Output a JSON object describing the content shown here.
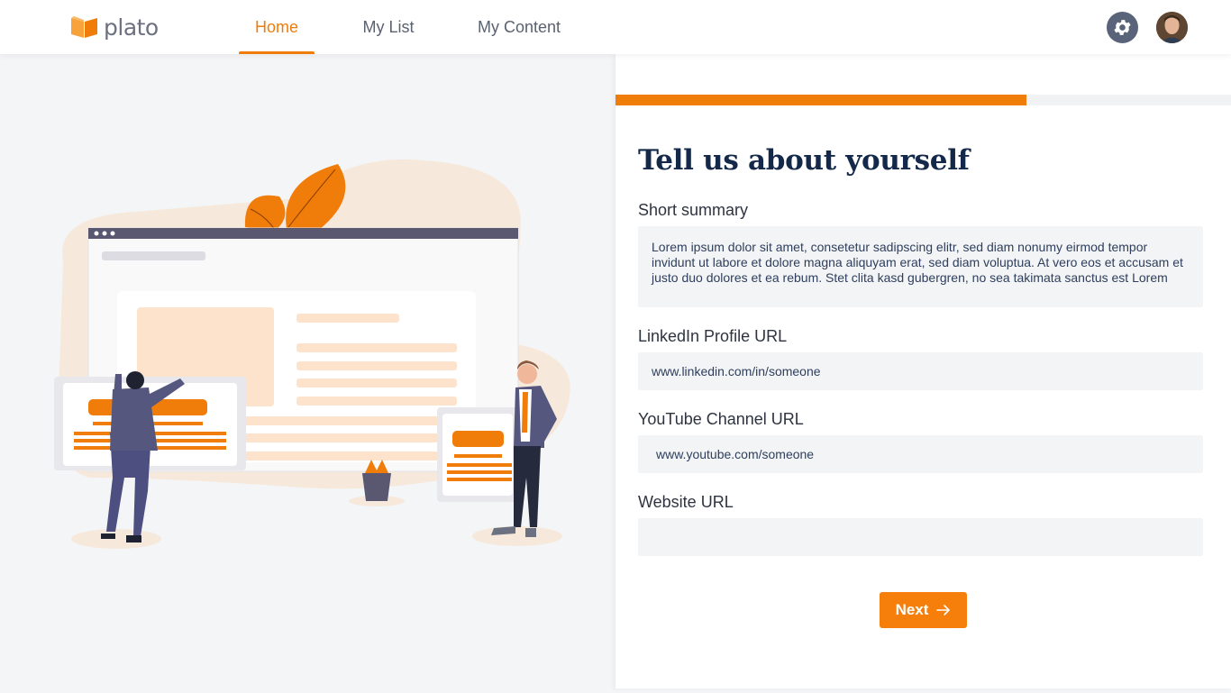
{
  "app": {
    "name": "plato"
  },
  "nav": {
    "tabs": [
      {
        "label": "Home",
        "active": true
      },
      {
        "label": "My List",
        "active": false
      },
      {
        "label": "My Content",
        "active": false
      }
    ]
  },
  "header_icons": {
    "settings": "gear-icon",
    "avatar": "user-avatar"
  },
  "progress": {
    "fraction": 0.667
  },
  "form": {
    "title": "Tell us about yourself",
    "summary": {
      "label": "Short summary",
      "value": "Lorem ipsum dolor sit amet, consetetur sadipscing elitr, sed diam nonumy eirmod tempor invidunt ut labore et dolore magna aliquyam erat, sed diam voluptua. At vero eos et accusam et justo duo dolores et ea rebum. Stet clita kasd gubergren, no sea takimata sanctus est Lorem"
    },
    "linkedin": {
      "label": "LinkedIn Profile URL",
      "value": "www.linkedin.com/in/someone"
    },
    "youtube": {
      "label": "YouTube Channel URL",
      "value": "www.youtube.com/someone"
    },
    "website": {
      "label": "Website URL",
      "value": ""
    },
    "next_label": "Next"
  },
  "colors": {
    "accent": "#f07c0a",
    "title": "#14294a",
    "field_bg": "#f3f4f6"
  }
}
